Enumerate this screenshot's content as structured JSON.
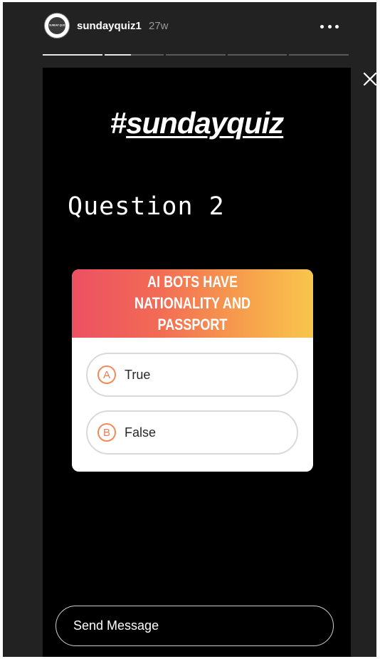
{
  "header": {
    "avatar_text": "SUNDAY QUIZ",
    "username": "sundayquiz1",
    "time_ago": "27w"
  },
  "progress": {
    "segments": 5,
    "current_index": 1,
    "current_fraction": 0.45,
    "bar_color": "#e6e6e6",
    "track_color": "#5a5a5a"
  },
  "story": {
    "hashtag_symbol": "#",
    "hashtag_word": "sundayquiz",
    "question_heading": "Question 2",
    "quiz": {
      "question": "AI BOTS HAVE NATIONALITY AND PASSPORT",
      "gradient_colors": [
        "#ec5063",
        "#f7a44b",
        "#f8c64d"
      ],
      "options": [
        {
          "letter": "A",
          "text": "True"
        },
        {
          "letter": "B",
          "text": "False"
        }
      ]
    }
  },
  "footer": {
    "send_placeholder": "Send Message"
  },
  "icons": {
    "more": "more-horizontal-icon",
    "close": "close-icon"
  }
}
